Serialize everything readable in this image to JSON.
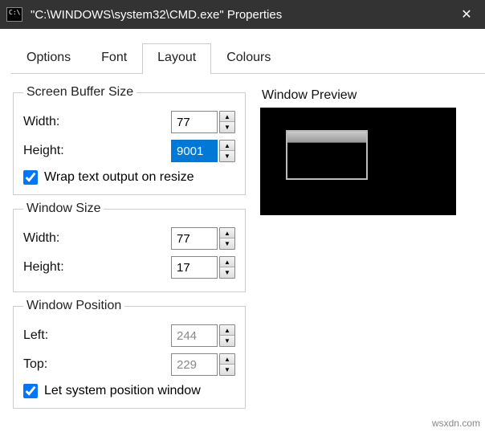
{
  "window": {
    "icon_text": "C:\\",
    "title": "\"C:\\WINDOWS\\system32\\CMD.exe\" Properties",
    "close_glyph": "✕"
  },
  "tabs": {
    "options": "Options",
    "font": "Font",
    "layout": "Layout",
    "colours": "Colours",
    "active": "layout"
  },
  "screenBuffer": {
    "legend": "Screen Buffer Size",
    "widthLabel": "Width:",
    "width": "77",
    "heightLabel": "Height:",
    "height": "9001",
    "wrapLabel": "Wrap text output on resize",
    "wrapChecked": true
  },
  "windowSize": {
    "legend": "Window Size",
    "widthLabel": "Width:",
    "width": "77",
    "heightLabel": "Height:",
    "height": "17"
  },
  "windowPosition": {
    "legend": "Window Position",
    "leftLabel": "Left:",
    "left": "244",
    "topLabel": "Top:",
    "top": "229",
    "autoLabel": "Let system position window",
    "autoChecked": true
  },
  "preview": {
    "label": "Window Preview"
  },
  "watermark": "wsxdn.com"
}
